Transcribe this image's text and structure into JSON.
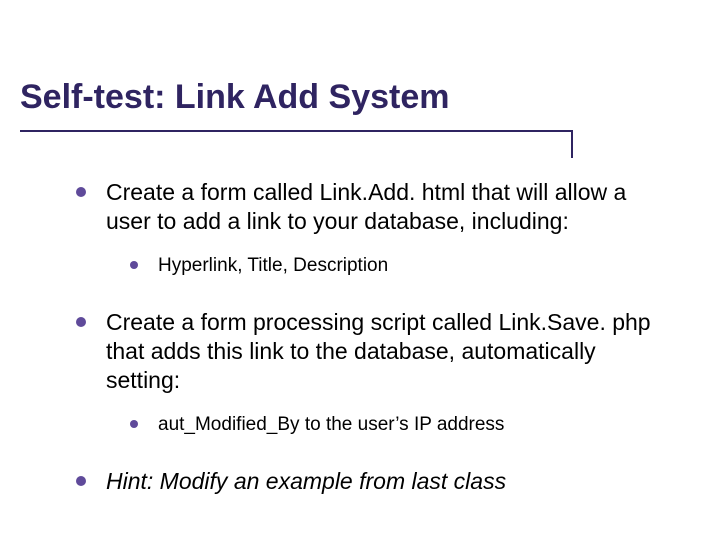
{
  "title": "Self-test: Link Add System",
  "bullets": {
    "b1": "Create a form called Link.Add. html that will allow a user to add a link to your database, including:",
    "b1_sub1": "Hyperlink, Title, Description",
    "b2": "Create a form processing script called Link.Save. php that adds this link to the database, automatically setting:",
    "b2_sub1": "aut_Modified_By to the user’s IP address",
    "b3": "Hint: Modify an example from last class"
  }
}
